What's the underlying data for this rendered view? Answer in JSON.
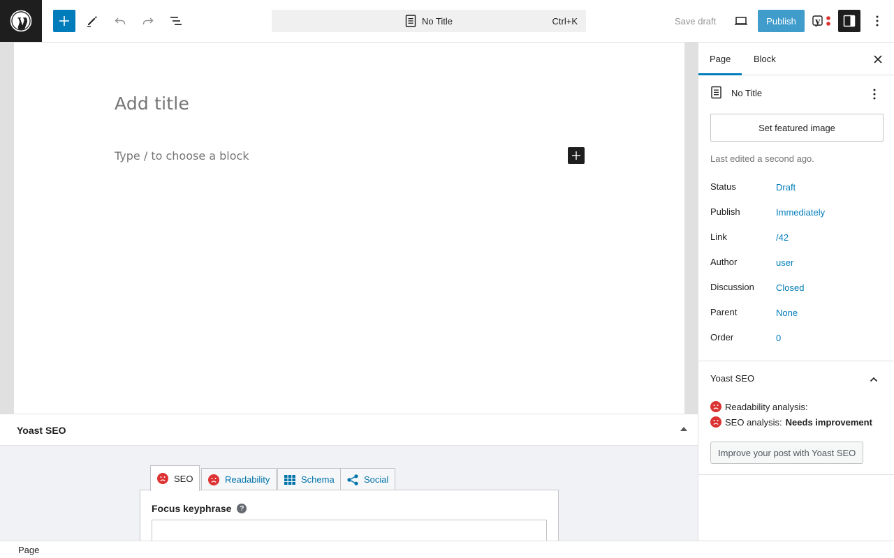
{
  "topbar": {
    "doc_title": "No Title",
    "shortcut": "Ctrl+K",
    "save_draft": "Save draft",
    "publish": "Publish"
  },
  "editor": {
    "title_placeholder": "Add title",
    "block_placeholder": "Type / to choose a block"
  },
  "yoast_metabox": {
    "title": "Yoast SEO",
    "tabs": [
      {
        "label": "SEO",
        "icon": "sad-face-icon"
      },
      {
        "label": "Readability",
        "icon": "sad-face-icon"
      },
      {
        "label": "Schema",
        "icon": "grid-icon"
      },
      {
        "label": "Social",
        "icon": "share-icon"
      }
    ],
    "focus_keyphrase_label": "Focus keyphrase",
    "help": "?"
  },
  "statusbar": {
    "breadcrumb": "Page"
  },
  "sidebar": {
    "tabs": [
      "Page",
      "Block"
    ],
    "doc_title": "No Title",
    "featured_image_btn": "Set featured image",
    "last_edited": "Last edited a second ago.",
    "meta": [
      {
        "key": "Status",
        "value": "Draft"
      },
      {
        "key": "Publish",
        "value": "Immediately"
      },
      {
        "key": "Link",
        "value": "/42"
      },
      {
        "key": "Author",
        "value": "user"
      },
      {
        "key": "Discussion",
        "value": "Closed"
      },
      {
        "key": "Parent",
        "value": "None"
      },
      {
        "key": "Order",
        "value": "0"
      }
    ],
    "yoast": {
      "title": "Yoast SEO",
      "readability_label": "Readability analysis:",
      "seo_label": "SEO analysis:",
      "seo_value": "Needs improvement",
      "improve_btn": "Improve your post with Yoast SEO"
    }
  },
  "colors": {
    "accent": "#007cba",
    "dark": "#1e1e1e",
    "bad": "#dc3232"
  }
}
